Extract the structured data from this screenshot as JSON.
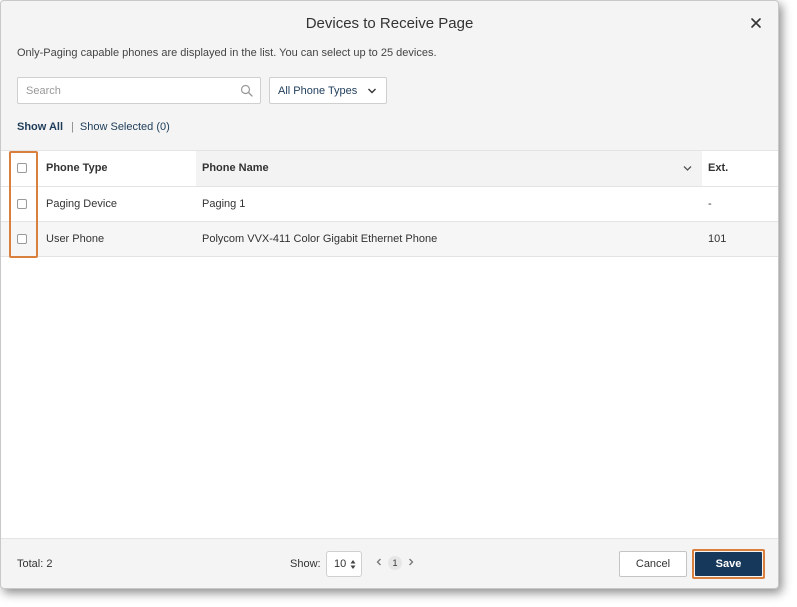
{
  "dialog": {
    "title": "Devices to Receive Page",
    "subtitle": "Only-Paging capable phones are displayed in the list. You can select up to 25 devices."
  },
  "search": {
    "placeholder": "Search"
  },
  "filter": {
    "selected": "All Phone Types"
  },
  "tabs": {
    "show_all": "Show All",
    "separator": "|",
    "show_selected": "Show Selected (0)"
  },
  "table": {
    "columns": {
      "type": "Phone Type",
      "name": "Phone Name",
      "ext": "Ext."
    },
    "rows": [
      {
        "type": "Paging Device",
        "name": "Paging 1",
        "ext": "-"
      },
      {
        "type": "User Phone",
        "name": "Polycom VVX-411 Color Gigabit Ethernet Phone",
        "ext": "101"
      }
    ]
  },
  "footer": {
    "total": "Total: 2",
    "show_label": "Show:",
    "page_size": "10",
    "current_page": "1",
    "cancel_label": "Cancel",
    "save_label": "Save"
  },
  "colors": {
    "accent": "#16385a",
    "highlight": "#d9803f",
    "link": "#1e3c5a"
  },
  "icons": [
    "close-icon",
    "search-icon",
    "chevron-down-icon",
    "sort-chevron-icon",
    "stepper-arrows-icon",
    "chevron-left-icon",
    "chevron-right-icon"
  ]
}
